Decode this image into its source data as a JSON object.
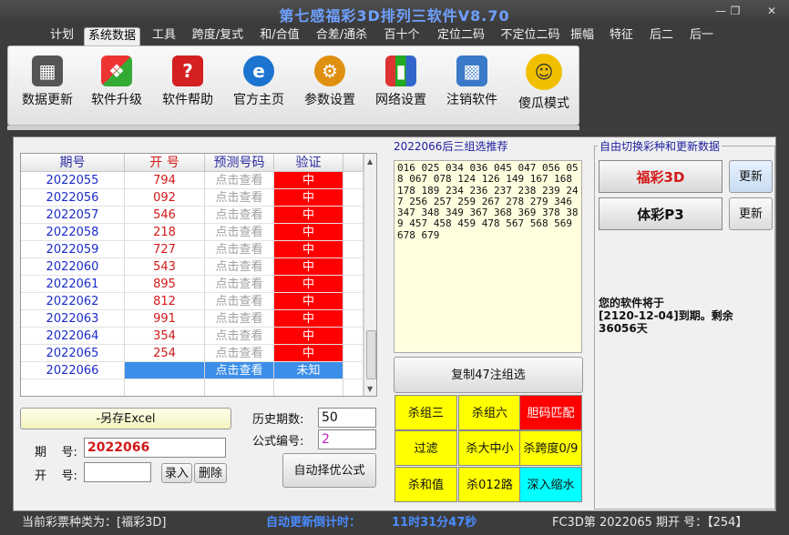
{
  "app_title": "第七感福彩3D排列三软件V8.70",
  "menu": [
    "计划",
    "系统数据",
    "工具",
    "跨度/复式",
    "和/合值",
    "合差/通杀",
    "百十个",
    "定位二码",
    "不定位二码",
    "振幅",
    "特征",
    "后二",
    "后一"
  ],
  "ribbon": [
    {
      "label": "数据更新",
      "icon": "chip-icon",
      "color": "#555555"
    },
    {
      "label": "软件升级",
      "icon": "windows-icon",
      "color": "#2f8fd8"
    },
    {
      "label": "软件帮助",
      "icon": "help-icon",
      "color": "#d42020"
    },
    {
      "label": "官方主页",
      "icon": "ie-icon",
      "color": "#1a74d0"
    },
    {
      "label": "参数设置",
      "icon": "gears-icon",
      "color": "#e09010"
    },
    {
      "label": "网络设置",
      "icon": "bars-icon",
      "color": "#2ca050"
    },
    {
      "label": "注销软件",
      "icon": "monitor-icon",
      "color": "#3a7ac8"
    },
    {
      "label": "傻瓜模式",
      "icon": "smiley-icon",
      "color": "#f0c000"
    }
  ],
  "table": {
    "headers": [
      "期号",
      "开 号",
      "预测号码",
      "验证"
    ],
    "rows": [
      {
        "issue": "2022055",
        "num": "794",
        "pred": "点击查看",
        "ver": "中"
      },
      {
        "issue": "2022056",
        "num": "092",
        "pred": "点击查看",
        "ver": "中"
      },
      {
        "issue": "2022057",
        "num": "546",
        "pred": "点击查看",
        "ver": "中"
      },
      {
        "issue": "2022058",
        "num": "218",
        "pred": "点击查看",
        "ver": "中"
      },
      {
        "issue": "2022059",
        "num": "727",
        "pred": "点击查看",
        "ver": "中"
      },
      {
        "issue": "2022060",
        "num": "543",
        "pred": "点击查看",
        "ver": "中"
      },
      {
        "issue": "2022061",
        "num": "895",
        "pred": "点击查看",
        "ver": "中"
      },
      {
        "issue": "2022062",
        "num": "812",
        "pred": "点击查看",
        "ver": "中"
      },
      {
        "issue": "2022063",
        "num": "991",
        "pred": "点击查看",
        "ver": "中"
      },
      {
        "issue": "2022064",
        "num": "354",
        "pred": "点击查看",
        "ver": "中"
      },
      {
        "issue": "2022065",
        "num": "254",
        "pred": "点击查看",
        "ver": "中"
      },
      {
        "issue": "2022066",
        "num": "",
        "pred": "点击查看",
        "ver": "未知"
      }
    ]
  },
  "recommend": {
    "title": "2022066后三组选推荐",
    "numbers": "016 025 034 036 045 047 056 058 067 078 124 126 149 167 168 178 189 234 236 237 238 239 247 256 257 259 267 278 279 346 347 348 349 367 368 369 378 389 457 458 459 478 567 568 569 678 679",
    "copy_button": "复制47注组选"
  },
  "kill_buttons": [
    {
      "label": "杀组三",
      "style": "y"
    },
    {
      "label": "杀组六",
      "style": "y"
    },
    {
      "label": "胆码匹配",
      "style": "r"
    },
    {
      "label": "过滤",
      "style": "y"
    },
    {
      "label": "杀大中小",
      "style": "y"
    },
    {
      "label": "杀跨度0/9",
      "style": "y"
    },
    {
      "label": "杀和值",
      "style": "y"
    },
    {
      "label": "杀012路",
      "style": "y"
    },
    {
      "label": "深入缩水",
      "style": "c"
    }
  ],
  "lottery": {
    "title": "自由切换彩种和更新数据",
    "fc3d": "福彩3D",
    "p3": "体彩P3",
    "update": "更新",
    "expiry_line1": "您的软件将于",
    "expiry_line2": "[2120-12-04]到期。剩余",
    "expiry_line3": "36056天"
  },
  "form": {
    "export_button": "-另存Excel",
    "history_label": "历史期数:",
    "history_value": "50",
    "formula_label": "公式编号:",
    "formula_value": "2",
    "auto_button": "自动择优公式",
    "issue_label": "期    号:",
    "issue_value": "2022066",
    "open_label": "开    号:",
    "open_value": "",
    "enter_button": "录入",
    "delete_button": "删除"
  },
  "status": {
    "type_text": "当前彩票种类为：[福彩3D]",
    "countdown_label": "自动更新倒计时：",
    "countdown_value": "11时31分47秒",
    "draw_text": "FC3D第 2022065 期开  号：【254】"
  },
  "colors": {
    "accent_title": "#6fa0ff",
    "countdown": "#4a8cff",
    "hit": "#ff0000",
    "unknown": "#3c8ee8"
  }
}
